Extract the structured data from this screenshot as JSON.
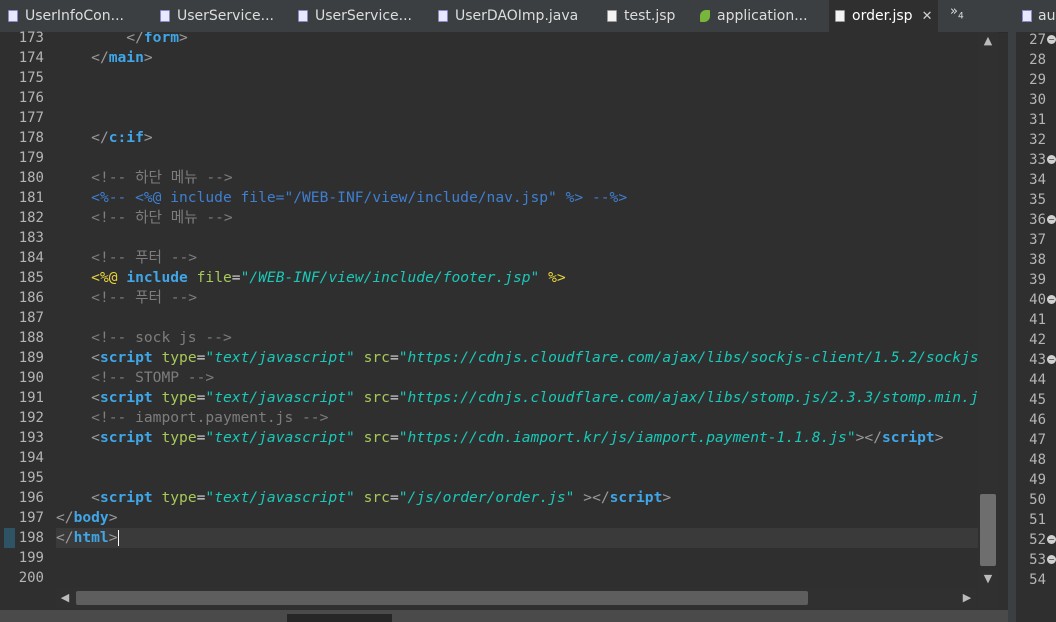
{
  "tabs": [
    {
      "label": "UserInfoCon...",
      "icon": "java-file-icon"
    },
    {
      "label": "UserService...",
      "icon": "java-file-icon"
    },
    {
      "label": "UserService...",
      "icon": "java-file-icon"
    },
    {
      "label": "UserDAOImp.java",
      "icon": "java-file-icon"
    },
    {
      "label": "test.jsp",
      "icon": "jsp-file-icon"
    },
    {
      "label": "application...",
      "icon": "spring-leaf-icon"
    },
    {
      "label": "order.jsp",
      "icon": "jsp-file-icon",
      "active": true,
      "close": "✕"
    }
  ],
  "overflow": {
    "symbol": "»",
    "count": "4"
  },
  "side_tab": {
    "label": "au",
    "icon": "java-file-icon"
  },
  "code_lines": [
    {
      "n": "173",
      "html": "        <span class=\"br\">&lt;/</span><span class=\"tg\">form</span><span class=\"br\">&gt;</span>"
    },
    {
      "n": "174",
      "html": "    <span class=\"br\">&lt;/</span><span class=\"tg\">main</span><span class=\"br\">&gt;</span>"
    },
    {
      "n": "175",
      "html": ""
    },
    {
      "n": "176",
      "html": ""
    },
    {
      "n": "177",
      "html": ""
    },
    {
      "n": "178",
      "html": "    <span class=\"br\">&lt;/</span><span class=\"tg\">c:if</span><span class=\"br\">&gt;</span>"
    },
    {
      "n": "179",
      "html": ""
    },
    {
      "n": "180",
      "html": "    <span class=\"cm\">&lt;!-- 하단 메뉴 --&gt;</span>"
    },
    {
      "n": "181",
      "html": "    <span class=\"jcm\">&lt;%-- &lt;%@ include file=\"/WEB-INF/view/include/nav.jsp\" %&gt; --%&gt;</span>"
    },
    {
      "n": "182",
      "html": "    <span class=\"cm\">&lt;!-- 하단 메뉴 --&gt;</span>"
    },
    {
      "n": "183",
      "html": ""
    },
    {
      "n": "184",
      "html": "    <span class=\"cm\">&lt;!-- 푸터 --&gt;</span>"
    },
    {
      "n": "185",
      "html": "    <span class=\"pt\">&lt;%@</span> <span class=\"tg\">include</span> <span class=\"at\">file</span>=<span class=\"av\">\"/WEB-INF/view/include/footer.jsp\"</span> <span class=\"pt\">%&gt;</span>"
    },
    {
      "n": "186",
      "html": "    <span class=\"cm\">&lt;!-- 푸터 --&gt;</span>"
    },
    {
      "n": "187",
      "html": ""
    },
    {
      "n": "188",
      "html": "    <span class=\"cm\">&lt;!-- sock js --&gt;</span>"
    },
    {
      "n": "189",
      "html": "    <span class=\"br\">&lt;</span><span class=\"tg\">script</span> <span class=\"at\">type</span>=<span class=\"av\">\"text/javascript\"</span> <span class=\"at\">src</span>=<span class=\"av\">\"https://cdnjs.cloudflare.com/ajax/libs/sockjs-client/1.5.2/sockjs.min.js\"</span><span class=\"br\">&gt;&lt;/</span><span class=\"tg\">script</span><span class=\"br\">&gt;</span>"
    },
    {
      "n": "190",
      "html": "    <span class=\"cm\">&lt;!-- STOMP --&gt;</span>"
    },
    {
      "n": "191",
      "html": "    <span class=\"br\">&lt;</span><span class=\"tg\">script</span> <span class=\"at\">type</span>=<span class=\"av\">\"text/javascript\"</span> <span class=\"at\">src</span>=<span class=\"av\">\"https://cdnjs.cloudflare.com/ajax/libs/stomp.js/2.3.3/stomp.min.js\"</span><span class=\"br\">&gt;&lt;/</span><span class=\"tg\">script</span><span class=\"br\">&gt;</span>"
    },
    {
      "n": "192",
      "html": "    <span class=\"cm\">&lt;!-- iamport.payment.js --&gt;</span>"
    },
    {
      "n": "193",
      "html": "    <span class=\"br\">&lt;</span><span class=\"tg\">script</span> <span class=\"at\">type</span>=<span class=\"av\">\"text/javascript\"</span> <span class=\"at\">src</span>=<span class=\"av\">\"https://cdn.iamport.kr/js/iamport.payment-1.1.8.js\"</span><span class=\"br\">&gt;&lt;/</span><span class=\"tg\">script</span><span class=\"br\">&gt;</span>"
    },
    {
      "n": "194",
      "html": ""
    },
    {
      "n": "195",
      "html": ""
    },
    {
      "n": "196",
      "html": "    <span class=\"br\">&lt;</span><span class=\"tg\">script</span> <span class=\"at\">type</span>=<span class=\"av\">\"text/javascript\"</span> <span class=\"at\">src</span>=<span class=\"av\">\"/js/order/order.js\"</span> <span class=\"br\">&gt;&lt;/</span><span class=\"tg\">script</span><span class=\"br\">&gt;</span>"
    },
    {
      "n": "197",
      "html": "<span class=\"br\">&lt;/</span><span class=\"tg\">body</span><span class=\"br\">&gt;</span>"
    },
    {
      "n": "198",
      "html": "<span class=\"br\">&lt;/</span><span class=\"tg\">html</span><span class=\"br\">&gt;</span><span class=\"caret\"></span>",
      "current": true
    },
    {
      "n": "199",
      "html": ""
    },
    {
      "n": "200",
      "html": ""
    }
  ],
  "side_lines": [
    {
      "n": "27",
      "fold": true
    },
    {
      "n": "28"
    },
    {
      "n": "29"
    },
    {
      "n": "30"
    },
    {
      "n": "31"
    },
    {
      "n": "32"
    },
    {
      "n": "33",
      "fold": true
    },
    {
      "n": "34"
    },
    {
      "n": "35"
    },
    {
      "n": "36",
      "fold": true
    },
    {
      "n": "37"
    },
    {
      "n": "38"
    },
    {
      "n": "39"
    },
    {
      "n": "40",
      "fold": true
    },
    {
      "n": "41"
    },
    {
      "n": "42"
    },
    {
      "n": "43",
      "fold": true
    },
    {
      "n": "44"
    },
    {
      "n": "45"
    },
    {
      "n": "46"
    },
    {
      "n": "47"
    },
    {
      "n": "48"
    },
    {
      "n": "49"
    },
    {
      "n": "50"
    },
    {
      "n": "51"
    },
    {
      "n": "52",
      "fold": true
    },
    {
      "n": "53",
      "fold": true
    },
    {
      "n": "54"
    }
  ],
  "colors": {
    "tag": "#3fa6e8",
    "attr": "#a7c957",
    "value": "#19c8b8",
    "comment": "#7d7d7d",
    "jsp_comment": "#3f7fd0",
    "directive": "#e8d43a"
  }
}
